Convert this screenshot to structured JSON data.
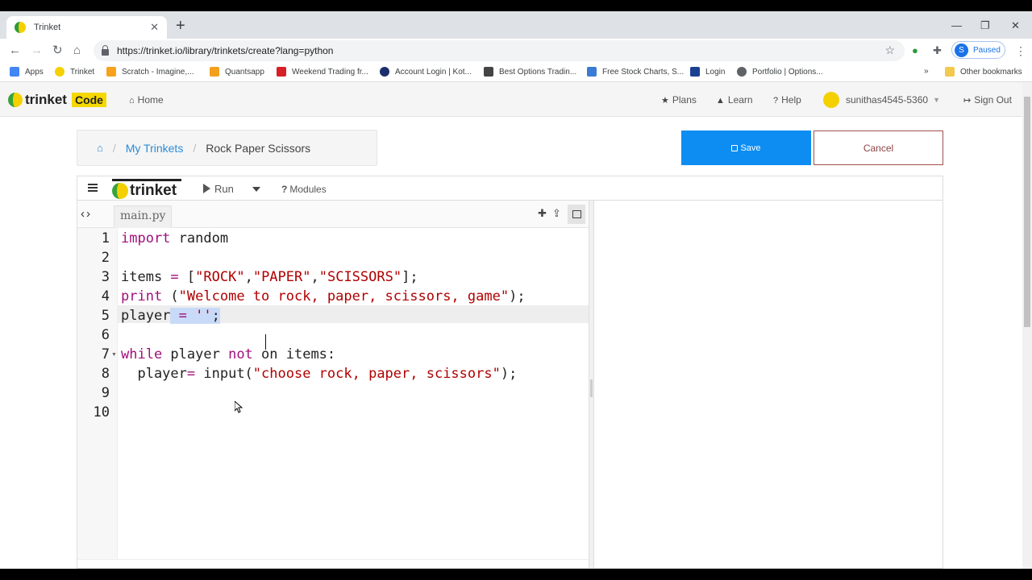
{
  "browser": {
    "tab_title": "Trinket",
    "url": "https://trinket.io/library/trinkets/create?lang=python",
    "profile_initial": "S",
    "profile_label": "Paused",
    "bookmarks": [
      {
        "label": "Apps",
        "color": "#4285f4"
      },
      {
        "label": "Trinket",
        "color": "#f5d000"
      },
      {
        "label": "Scratch - Imagine,...",
        "color": "#f7a21a"
      },
      {
        "label": "Quantsapp",
        "color": "#f3a11d"
      },
      {
        "label": "Weekend Trading fr...",
        "color": "#d61f26"
      },
      {
        "label": "Account Login | Kot...",
        "color": "#1b2e6b"
      },
      {
        "label": "Best Options Tradin...",
        "color": "#444444"
      },
      {
        "label": "Free Stock Charts, S...",
        "color": "#3a7bd5"
      },
      {
        "label": "Login",
        "color": "#1b3f91"
      },
      {
        "label": "Portfolio | Options...",
        "color": "#5f6368"
      }
    ],
    "bookmarks_overflow": "»",
    "other_bookmarks": "Other bookmarks"
  },
  "site_nav": {
    "logo_word": "trinket",
    "logo_badge": "Code",
    "home": "Home",
    "plans": "Plans",
    "learn": "Learn",
    "help": "Help",
    "username": "sunithas4545-5360",
    "sign_out": "Sign Out"
  },
  "breadcrumb": {
    "my_trinkets": "My Trinkets",
    "current": "Rock Paper Scissors"
  },
  "actions": {
    "save": "Save",
    "cancel": "Cancel"
  },
  "editor": {
    "logo_word": "trinket",
    "run": "Run",
    "modules": "Modules",
    "file_tab": "main.py",
    "line_numbers": [
      "1",
      "2",
      "3",
      "4",
      "5",
      "6",
      "7",
      "8",
      "9",
      "10"
    ],
    "active_line": 5,
    "code": {
      "l1_kw": "import",
      "l1_rest": " random",
      "l3_a": "items ",
      "l3_op": "=",
      "l3_b": " [",
      "l3_s1": "\"ROCK\"",
      "l3_c1": ",",
      "l3_s2": "\"PAPER\"",
      "l3_c2": ",",
      "l3_s3": "\"SCISSORS\"",
      "l3_end": "];",
      "l4_kw": "print",
      "l4_a": " (",
      "l4_s": "\"Welcome to rock, paper, scissors, game\"",
      "l4_end": ");",
      "l5_a": "player",
      "l5_sel_a": " ",
      "l5_op": "=",
      "l5_sel_b": " ",
      "l5_s": "''",
      "l5_end": ";",
      "l7_kw": "while",
      "l7_a": " player ",
      "l7_kw2": "not",
      "l7_b": " on items:",
      "l8_a": "  player",
      "l8_op": "=",
      "l8_b": " input(",
      "l8_s": "\"choose rock, paper, scissors\"",
      "l8_end": ");"
    }
  }
}
